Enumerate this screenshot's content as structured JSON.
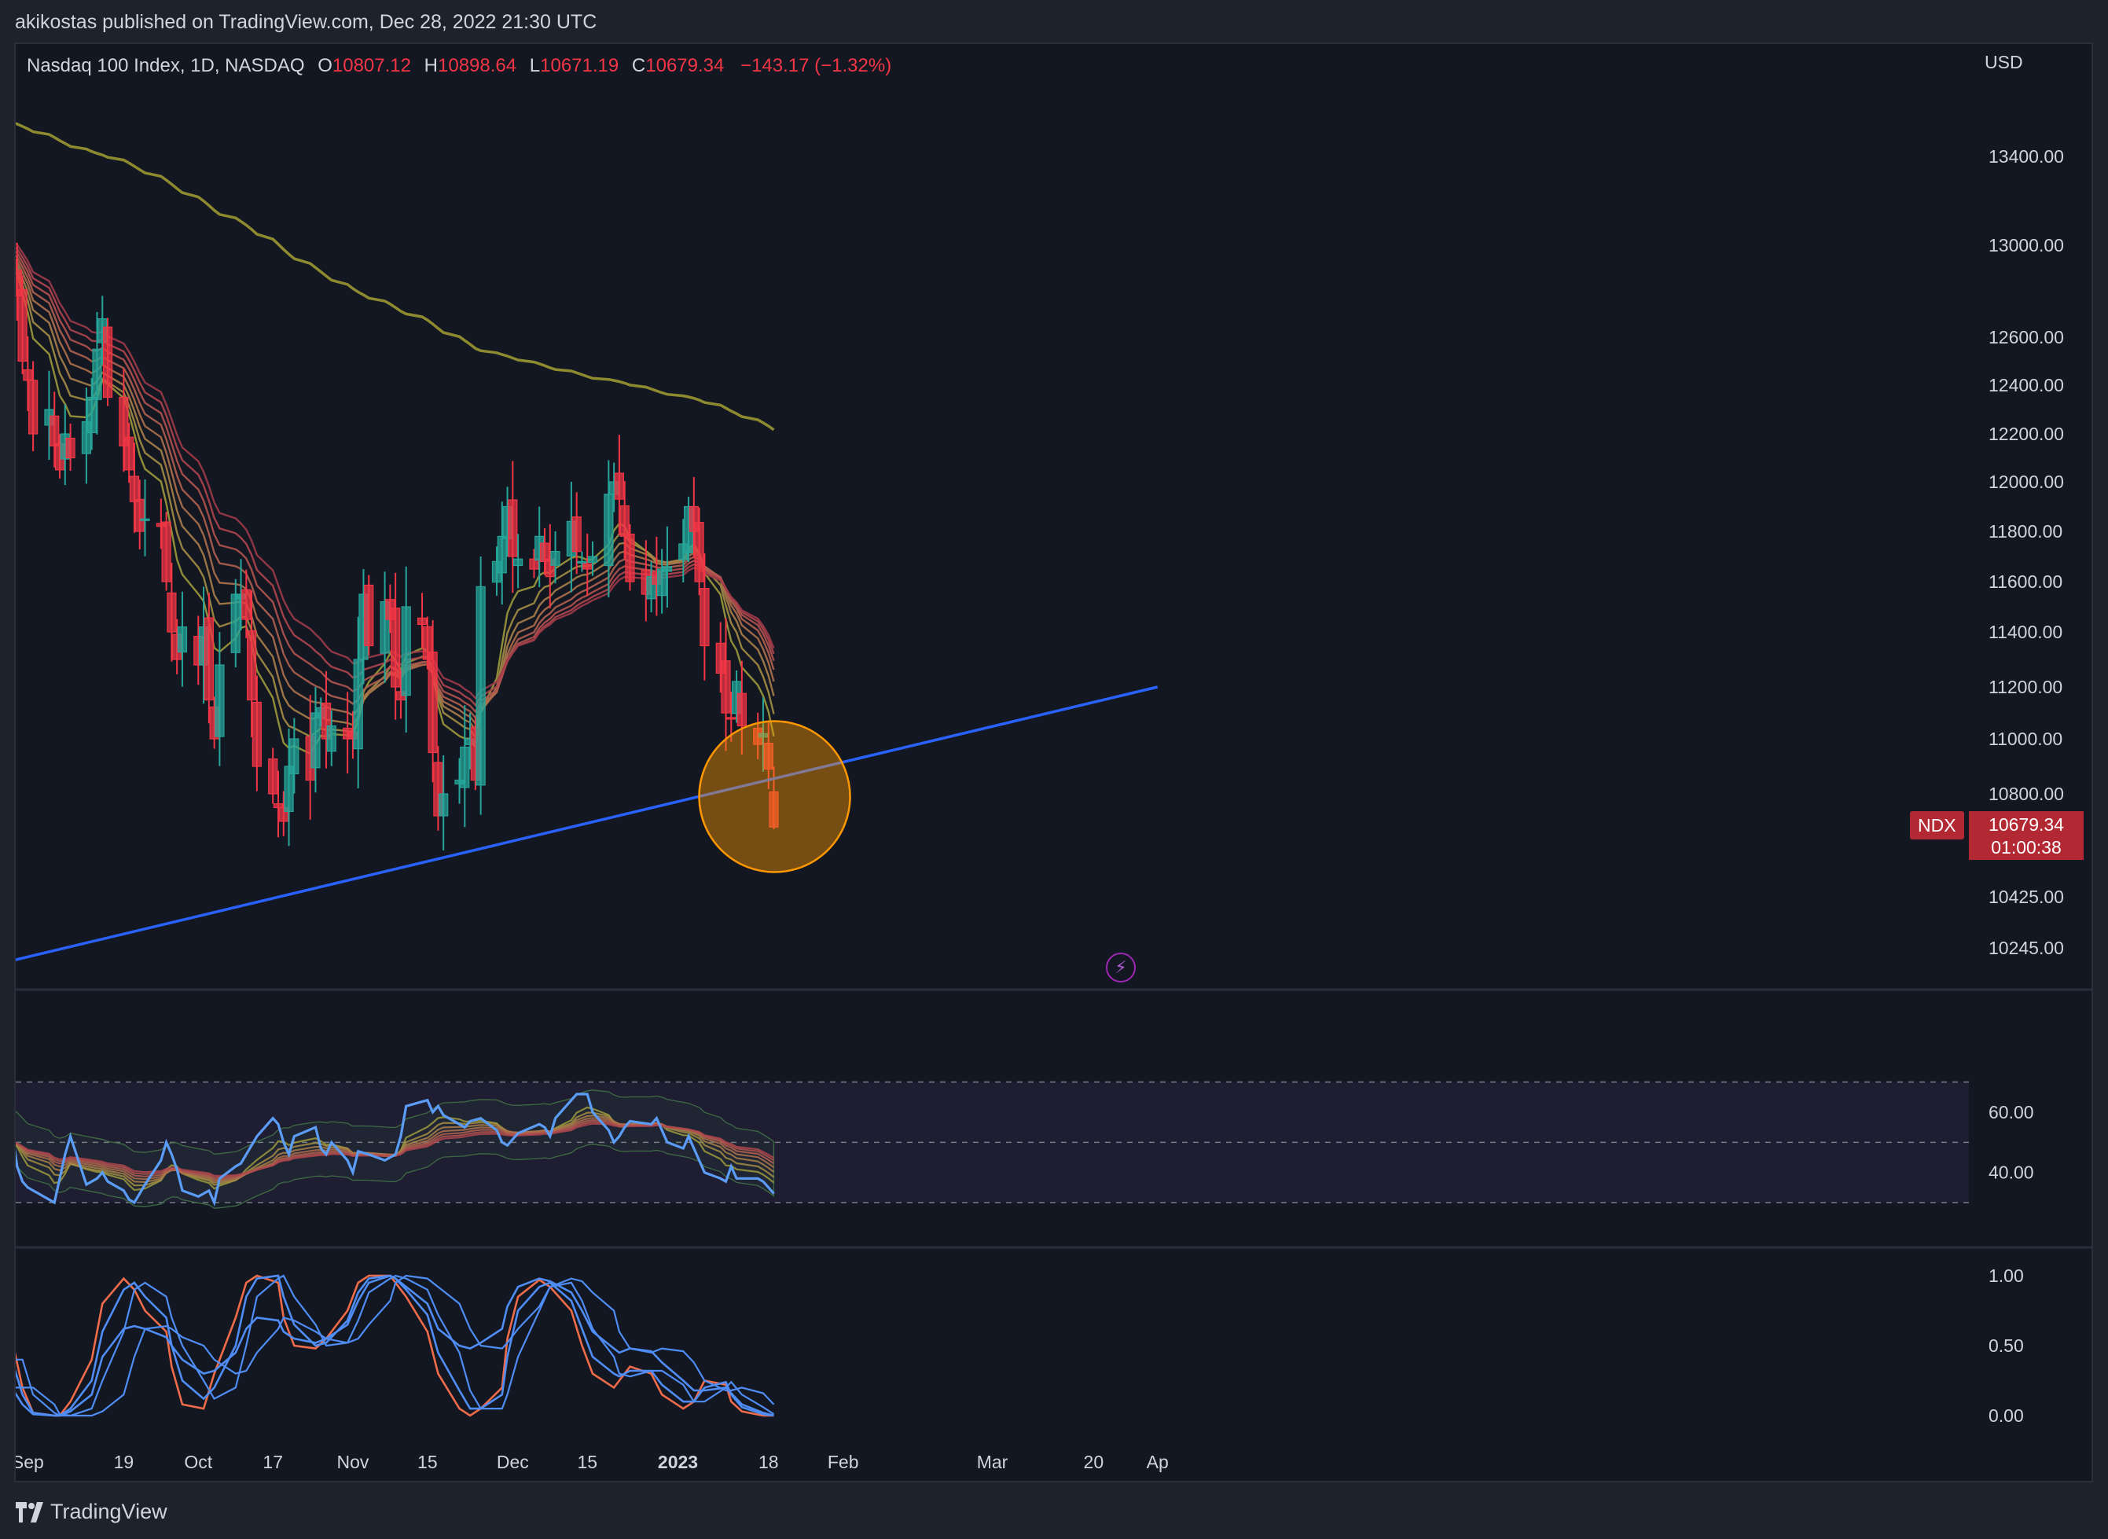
{
  "header": {
    "published": "akikostas published on TradingView.com, Dec 28, 2022 21:30 UTC"
  },
  "legend": {
    "name": "Nasdaq 100 Index, 1D, NASDAQ",
    "open_label": "O",
    "open": "10807.12",
    "high_label": "H",
    "high": "10898.64",
    "low_label": "L",
    "low": "10671.19",
    "close_label": "C",
    "close": "10679.34",
    "change": "−143.17 (−1.32%)"
  },
  "currency": "USD",
  "symbol_tag": "NDX",
  "last_price": "10679.34",
  "countdown": "01:00:38",
  "brand": "TradingView",
  "icons": {
    "alert": "lightning-bolt-icon",
    "logo": "tradingview-logo-icon"
  },
  "colors": {
    "up": "#26a69a",
    "down": "#f23645",
    "trendline": "#2962ff",
    "highlight": "#ff9800",
    "ma200": "#8e8a2f",
    "background": "#131722"
  },
  "chart_data": [
    {
      "type": "candlestick",
      "title": "Nasdaq 100 Index, 1D, NASDAQ",
      "price_axis_ticks": [
        "13400.00",
        "13000.00",
        "12600.00",
        "12400.00",
        "12200.00",
        "12000.00",
        "11800.00",
        "11600.00",
        "11400.00",
        "11200.00",
        "11000.00",
        "10800.00",
        "10425.00",
        "10245.00"
      ],
      "time_axis_ticks": [
        "Sep",
        "19",
        "Oct",
        "17",
        "Nov",
        "15",
        "Dec",
        "15",
        "2023",
        "18",
        "Feb",
        "Mar",
        "20",
        "Ap"
      ],
      "close_series": [
        12900,
        12780,
        12500,
        12420,
        12200,
        12300,
        12150,
        12050,
        12200,
        12100,
        12250,
        12350,
        12550,
        12680,
        12350,
        12150,
        12050,
        11920,
        11800,
        11850,
        11820,
        11600,
        11400,
        11300,
        11420,
        11280,
        11420,
        11150,
        11000,
        11280,
        11550,
        11550,
        11450,
        11150,
        10900,
        10800,
        10750,
        10700,
        10900,
        11000,
        10850,
        11100,
        11120,
        11000,
        11050,
        11000,
        11000,
        11300,
        11550,
        11350,
        11520,
        11450,
        11200,
        11150,
        11500,
        11430,
        11300,
        10950,
        10720,
        10800,
        10850,
        10970,
        11000,
        10850,
        11580,
        11680,
        11780,
        11900,
        11700,
        11690,
        11650,
        11780,
        11680,
        11620,
        11720,
        11840,
        11720,
        11680,
        11650,
        11700,
        11950,
        12000,
        11930,
        11780,
        11600,
        11550,
        11620,
        11590,
        11650,
        11660,
        11750,
        11900,
        11800,
        11600,
        11350,
        11250,
        11100,
        11080,
        11220,
        11050,
        10980,
        11020,
        10890,
        10679.34
      ],
      "ohlc_last": {
        "open": 10807.12,
        "high": 10898.64,
        "low": 10671.19,
        "close": 10679.34
      },
      "trendline": [
        {
          "date": "2022-08-29",
          "price": 10200
        },
        {
          "date": "2023-04-01",
          "price": 11200
        }
      ],
      "overlays": [
        "EMA ribbon",
        "200-day moving average"
      ]
    },
    {
      "type": "line",
      "indicator": "RSI with ribbon",
      "y_ticks": [
        "60.00",
        "40.00"
      ],
      "levels": [
        70,
        50,
        30
      ],
      "values": [
        54,
        42,
        37,
        35,
        31,
        30,
        38,
        46,
        52,
        36,
        38,
        40,
        37,
        34,
        31,
        30,
        36,
        44,
        50,
        46,
        41,
        34,
        32,
        34,
        30,
        38,
        42,
        43,
        46,
        52,
        58,
        56,
        50,
        46,
        52,
        55,
        48,
        46,
        50,
        44,
        40,
        47,
        46,
        44,
        45,
        46,
        52,
        62,
        64,
        60,
        62,
        59,
        56,
        55,
        57,
        58,
        54,
        50,
        49,
        51,
        53,
        56,
        55,
        52,
        58,
        64,
        66,
        66,
        60,
        54,
        50,
        52,
        55,
        57,
        56,
        58,
        54,
        50,
        48,
        52,
        44,
        40,
        38,
        37,
        42,
        38,
        38,
        37,
        35,
        33
      ]
    },
    {
      "type": "line",
      "indicator": "Stochastic ribbon",
      "y_ticks": [
        "1.00",
        "0.50",
        "0.00"
      ],
      "series": [
        {
          "values": [
            0.55,
            0.2,
            0.02,
            0.0,
            0.0,
            0.1,
            0.4,
            0.8,
            0.98,
            0.9,
            0.75,
            0.6,
            0.35,
            0.08,
            0.05,
            0.3,
            0.7,
            0.95,
            1.0,
            0.95,
            0.7,
            0.5,
            0.48,
            0.55,
            0.75,
            0.95,
            1.0,
            1.0,
            0.95,
            0.85,
            0.6,
            0.3,
            0.05,
            0.0,
            0.05,
            0.2,
            0.55,
            0.85,
            0.97,
            0.92,
            0.75,
            0.5,
            0.3,
            0.2,
            0.25,
            0.35,
            0.3,
            0.15,
            0.05,
            0.1,
            0.25,
            0.22,
            0.1,
            0.03,
            0.0,
            0.0
          ]
        },
        {
          "values": [
            0.4,
            0.15,
            0.02,
            0.0,
            0.0,
            0.05,
            0.25,
            0.6,
            0.9,
            0.95,
            0.85,
            0.7,
            0.5,
            0.25,
            0.12,
            0.2,
            0.5,
            0.85,
            0.98,
            1.0,
            0.85,
            0.65,
            0.5,
            0.52,
            0.68,
            0.88,
            0.98,
            1.0,
            0.98,
            0.9,
            0.72,
            0.45,
            0.18,
            0.05,
            0.05,
            0.15,
            0.42,
            0.75,
            0.92,
            0.95,
            0.82,
            0.62,
            0.42,
            0.3,
            0.28,
            0.32,
            0.32,
            0.22,
            0.1,
            0.1,
            0.2,
            0.24,
            0.15,
            0.06,
            0.01,
            0.0
          ]
        },
        {
          "values": [
            0.2,
            0.08,
            0.01,
            0.0,
            0.0,
            0.03,
            0.15,
            0.42,
            0.62,
            0.64,
            0.62,
            0.56,
            0.5,
            0.4,
            0.3,
            0.32,
            0.45,
            0.62,
            0.7,
            0.68,
            0.6,
            0.55,
            0.52,
            0.55,
            0.65,
            0.82,
            0.95,
            1.0,
            0.98,
            0.92,
            0.8,
            0.62,
            0.5,
            0.48,
            0.52,
            0.62,
            0.78,
            0.92,
            0.98,
            0.96,
            0.88,
            0.75,
            0.6,
            0.48,
            0.45,
            0.48,
            0.46,
            0.38,
            0.25,
            0.18,
            0.18,
            0.2,
            0.16,
            0.08,
            0.02,
            0.0
          ]
        }
      ]
    }
  ]
}
